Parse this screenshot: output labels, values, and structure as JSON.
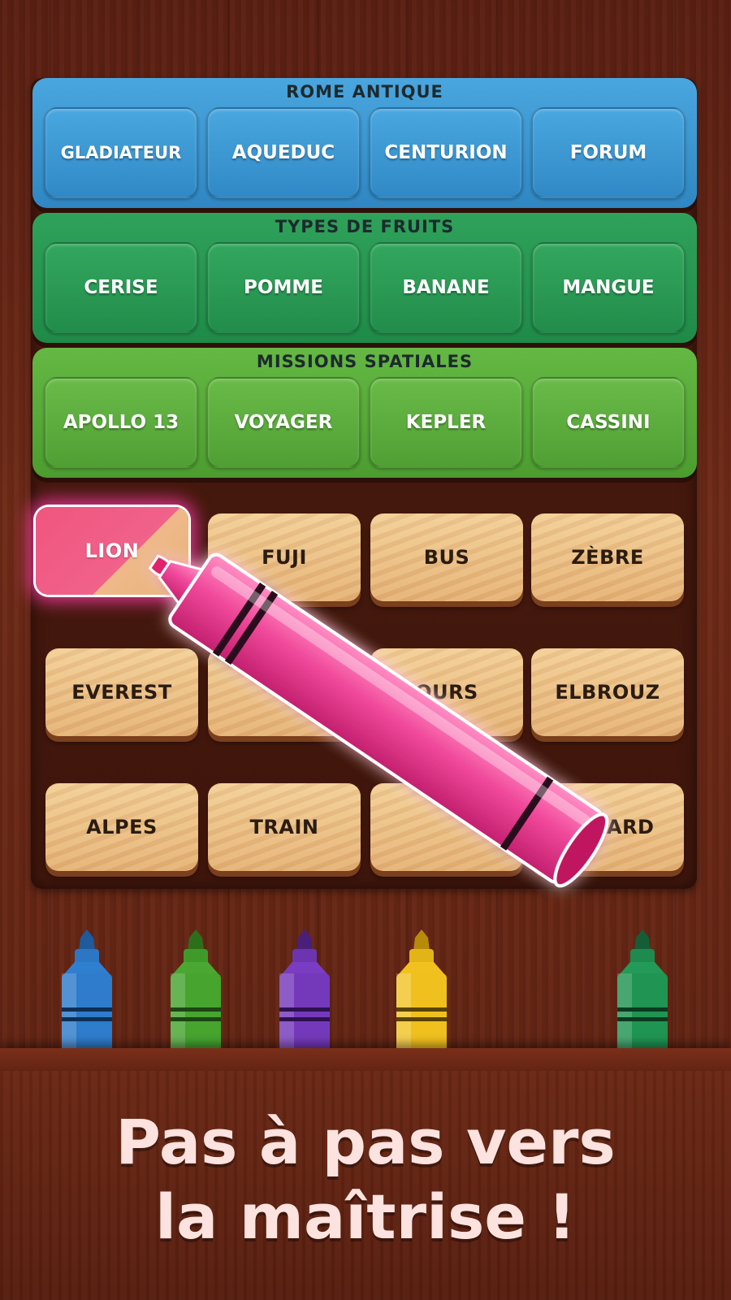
{
  "categories": [
    {
      "title": "ROME ANTIQUE",
      "words": [
        "GLADIATEUR",
        "AQUEDUC",
        "CENTURION",
        "FORUM"
      ]
    },
    {
      "title": "TYPES DE FRUITS",
      "words": [
        "CERISE",
        "POMME",
        "BANANE",
        "MANGUE"
      ]
    },
    {
      "title": "MISSIONS SPATIALES",
      "words": [
        "APOLLO 13",
        "VOYAGER",
        "KEPLER",
        "CASSINI"
      ]
    }
  ],
  "grid": {
    "rows": [
      [
        "LION",
        "FUJI",
        "BUS",
        "ZÈBRE"
      ],
      [
        "EVEREST",
        "",
        "OURS",
        "ELBROUZ"
      ],
      [
        "ALPES",
        "TRAIN",
        "",
        "RENARD"
      ]
    ],
    "selected": "LION"
  },
  "markers": [
    "blue",
    "green",
    "purple",
    "yellow",
    "teal"
  ],
  "tagline": {
    "line1": "Pas à pas vers",
    "line2": "la maîtrise !"
  },
  "colors": {
    "category_blue": "#3a93d0",
    "category_teal": "#27954f",
    "category_green": "#58aa3a",
    "selected_pink": "#f0557f",
    "tile_wood": "#eec38a"
  }
}
